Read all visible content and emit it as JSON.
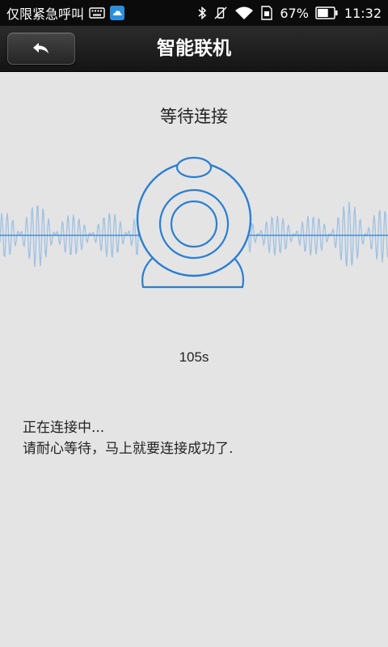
{
  "status_bar": {
    "carrier": "仅限紧急呼叫",
    "battery_percent": "67%",
    "battery_level": 0.67,
    "time": "11:32",
    "icons": [
      "keyboard-icon",
      "cloud-app-icon",
      "bluetooth-icon",
      "vibrate-mute-icon",
      "wifi-icon",
      "sim-icon",
      "battery-icon"
    ]
  },
  "header": {
    "title": "智能联机",
    "back_icon": "back-arrow-icon"
  },
  "main": {
    "waiting_title": "等待连接",
    "countdown": "105s",
    "message_line1": "正在连接中...",
    "message_line2": "请耐心等待，马上就要连接成功了."
  },
  "colors": {
    "accent": "#2a7fd0",
    "wave": "#9fc1e3",
    "background": "#e4e4e4",
    "header_bg": "#1c1c1c"
  }
}
